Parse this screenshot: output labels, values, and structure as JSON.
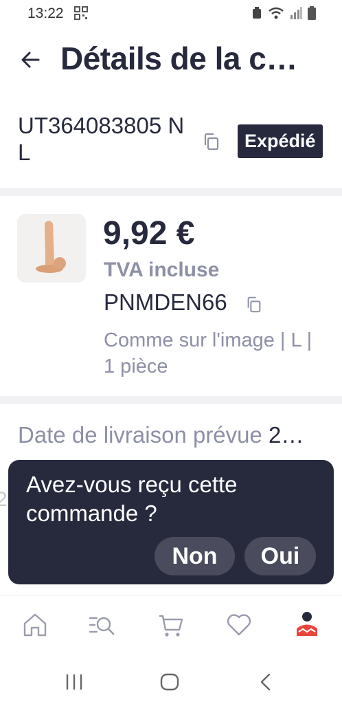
{
  "status_bar": {
    "time": "13:22",
    "icons": [
      "qr-code-icon",
      "recycle-icon",
      "wifi-icon",
      "signal-icon",
      "battery-icon"
    ]
  },
  "header": {
    "title": "Détails de la c…",
    "back_icon": "back-arrow-icon"
  },
  "order": {
    "id": "UT364083805 NL",
    "status": "Expédié",
    "copy_icon": "copy-icon"
  },
  "product": {
    "price": "9,92 €",
    "tax_note": "TVA incluse",
    "sku": "PNMDEN66",
    "variant": "Comme sur l'image | L | 1 pièce"
  },
  "delivery": {
    "label": "Date de livraison prévue",
    "value": "2…"
  },
  "peek_text": "2",
  "prompt": {
    "question": "Avez-vous reçu cette commande ?",
    "no_label": "Non",
    "yes_label": "Oui"
  },
  "bottom_nav": {
    "items": [
      "home-icon",
      "search-list-icon",
      "cart-icon",
      "heart-icon",
      "account-icon"
    ],
    "accent_color": "#e8453c"
  },
  "system_nav": [
    "recent-apps-icon",
    "home-button-icon",
    "back-icon"
  ],
  "colors": {
    "primary": "#272a3d",
    "secondary_text": "#8d90a6",
    "badge_bg": "#272a3d"
  }
}
